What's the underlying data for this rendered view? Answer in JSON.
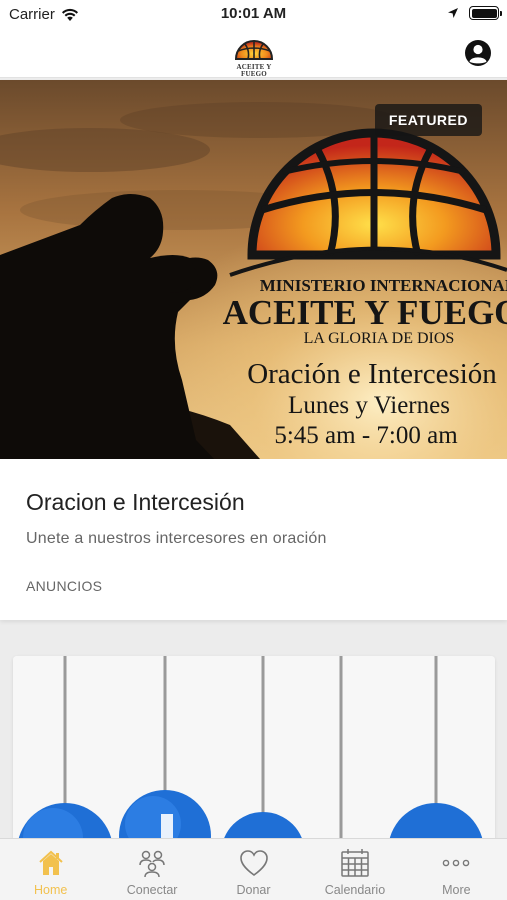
{
  "status_bar": {
    "carrier": "Carrier",
    "time": "10:01 AM",
    "battery_level": 1.0
  },
  "header": {
    "logo_text_line1": "ACEITE Y FUEGO",
    "profile_icon": "user-circle-icon"
  },
  "featured": {
    "badge": "FEATURED",
    "title": "Oracion e Intercesión",
    "subtitle": "Unete a nuestros intercesores en oración",
    "category": "ANUNCIOS",
    "poster": {
      "line1": "MINISTERIO INTERNACIONAL",
      "line2": "ACEITE Y FUEGO",
      "line3": "LA GLORIA DE DIOS",
      "line4": "Oración e Intercesión",
      "line5": "Lunes y Viernes",
      "line6": "5:45 am - 7:00 am"
    }
  },
  "tabs": [
    {
      "label": "Home",
      "icon": "home-icon",
      "active": true
    },
    {
      "label": "Conectar",
      "icon": "people-icon",
      "active": false
    },
    {
      "label": "Donar",
      "icon": "heart-icon",
      "active": false
    },
    {
      "label": "Calendario",
      "icon": "calendar-icon",
      "active": false
    },
    {
      "label": "More",
      "icon": "more-icon",
      "active": false
    }
  ],
  "colors": {
    "accent": "#f2c14e",
    "inactive": "#888888",
    "social_blue": "#1f6fd6"
  }
}
